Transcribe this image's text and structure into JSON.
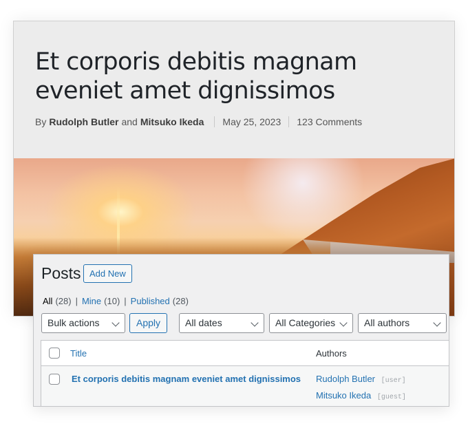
{
  "article": {
    "title": "Et corporis debitis magnam eveniet amet dignissimos",
    "meta": {
      "by_label": "By",
      "author1": "Rudolph Butler",
      "and_label": "and",
      "author2": "Mitsuko Ikeda",
      "date": "May 25, 2023",
      "comments": "123 Comments"
    },
    "hero_image": "sunset-landscape"
  },
  "admin": {
    "heading": "Posts",
    "add_new_label": "Add New",
    "filters": [
      {
        "label": "All",
        "count": "(28)",
        "current": true
      },
      {
        "label": "Mine",
        "count": "(10)",
        "current": false
      },
      {
        "label": "Published",
        "count": "(28)",
        "current": false
      }
    ],
    "separator": "|",
    "bulk_actions": {
      "selected": "Bulk actions"
    },
    "apply_label": "Apply",
    "dates": {
      "selected": "All dates"
    },
    "categories": {
      "selected": "All Categories"
    },
    "authors": {
      "selected": "All authors"
    },
    "table": {
      "columns": [
        "Title",
        "Authors"
      ],
      "rows": [
        {
          "title": "Et corporis debitis magnam eveniet amet dignissimos",
          "authors": [
            {
              "name": "Rudolph Butler",
              "role": "[user]"
            },
            {
              "name": "Mitsuko Ikeda",
              "role": "[guest]"
            }
          ]
        }
      ]
    }
  },
  "colors": {
    "link": "#2271b1",
    "heading": "#1d2327",
    "panel_bg": "#f0f0f1",
    "card_bg": "#ececec"
  }
}
